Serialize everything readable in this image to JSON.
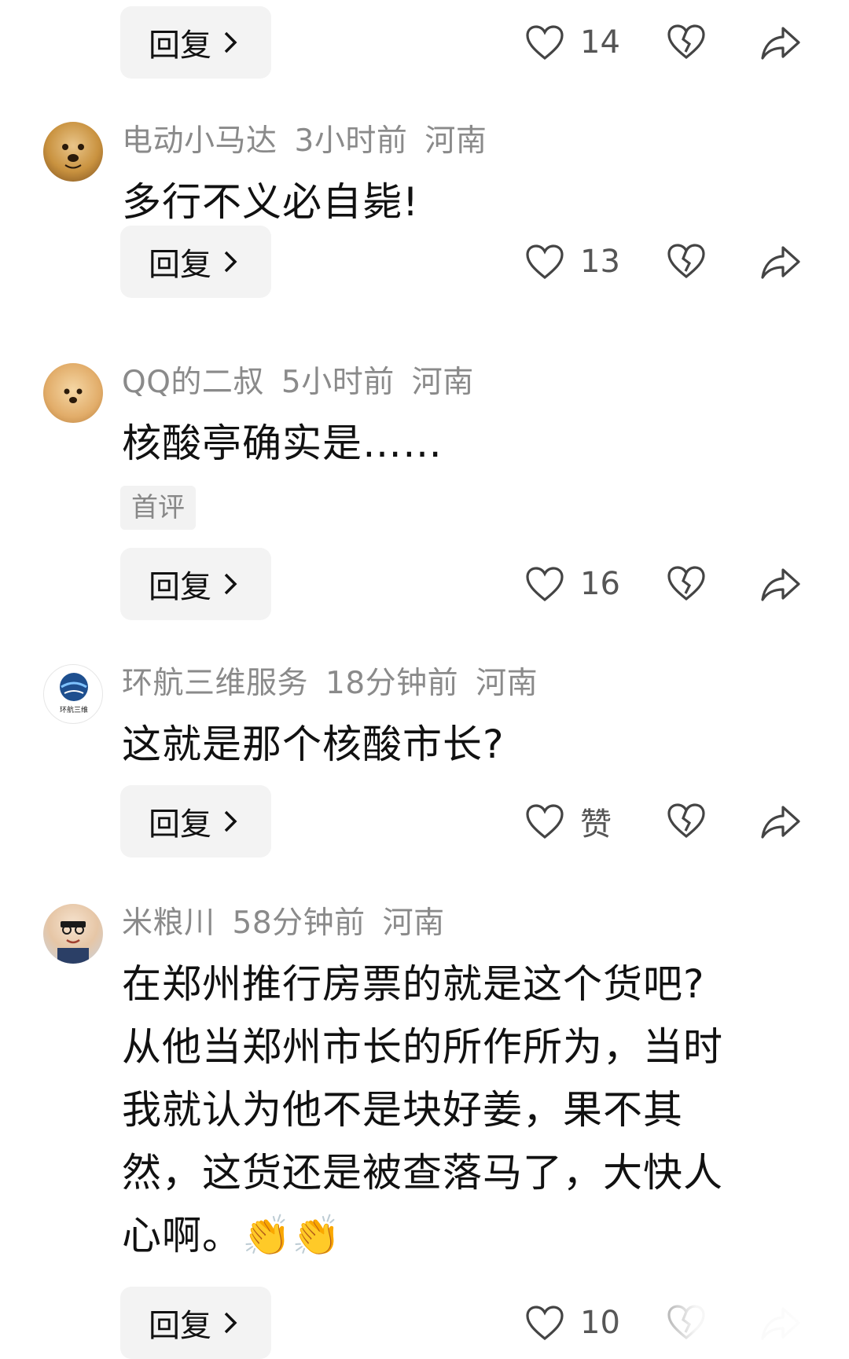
{
  "reply_label": "回复",
  "comments": [
    {
      "likes": "14"
    },
    {
      "user": "电动小马达",
      "time": "3小时前",
      "location": "河南",
      "text": "多行不义必自毙!",
      "likes": "13"
    },
    {
      "user": "QQ的二叔",
      "time": "5小时前",
      "location": "河南",
      "text": "核酸亭确实是……",
      "tag": "首评",
      "likes": "16"
    },
    {
      "user": "环航三维服务",
      "time": "18分钟前",
      "location": "河南",
      "text": "这就是那个核酸市长?",
      "likes": "赞",
      "avatar_text": "环航三维"
    },
    {
      "user": "米粮川",
      "time": "58分钟前",
      "location": "河南",
      "text_lines": [
        "在郑州推行房票的就是这个货吧?",
        "从他当郑州市长的所作所为，当时",
        "我就认为他不是块好姜，果不其",
        "然，这货还是被查落马了，大快人",
        "心啊。👏👏"
      ],
      "likes": "10"
    }
  ],
  "colors": {
    "meta": "#8a8a8a",
    "button_bg": "#f3f3f3",
    "text": "#111111"
  }
}
